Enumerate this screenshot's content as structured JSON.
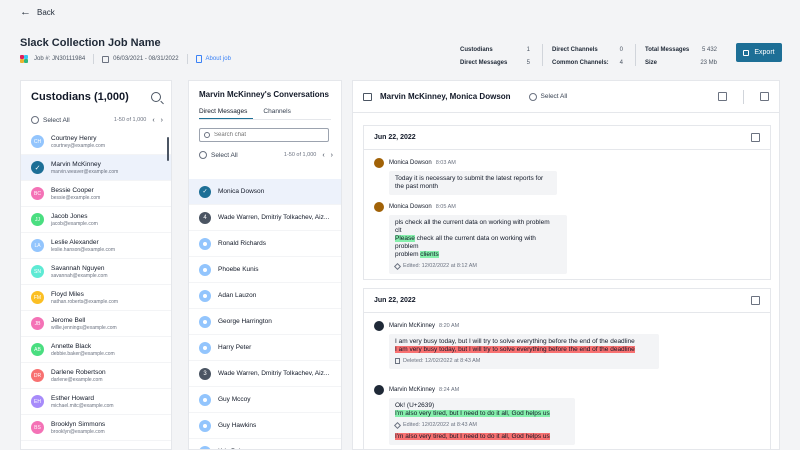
{
  "header": {
    "back_label": "Back",
    "job_title": "Slack Collection Job Name",
    "job_number": "Job #: JN30111984",
    "date_range": "06/03/2021 - 08/31/2022",
    "about_job": "About job",
    "export_label": "Export"
  },
  "stats": {
    "custodians_label": "Custodians",
    "custodians_value": "1",
    "direct_messages_label": "Direct Messages",
    "direct_messages_value": "5",
    "direct_channels_label": "Direct Channels",
    "direct_channels_value": "0",
    "common_channels_label": "Common Channels:",
    "common_channels_value": "4",
    "total_messages_label": "Total Messages",
    "total_messages_value": "5 432",
    "size_label": "Size",
    "size_value": "23 Mb"
  },
  "custodians": {
    "title": "Custodians (1,000)",
    "select_all": "Select All",
    "pager_text": "1-50 of 1,000",
    "items": [
      {
        "initials": "CH",
        "name": "Courtney Henry",
        "email": "courtney@example.com",
        "color": "#93c5fd"
      },
      {
        "initials": "",
        "name": "Marvin McKinney",
        "email": "marvin.weaver@example.com",
        "color": "#1d6f96"
      },
      {
        "initials": "BC",
        "name": "Bessie Cooper",
        "email": "bessie@example.com",
        "color": "#f472b6"
      },
      {
        "initials": "JJ",
        "name": "Jacob Jones",
        "email": "jacob@example.com",
        "color": "#4ade80"
      },
      {
        "initials": "LA",
        "name": "Leslie Alexander",
        "email": "leslie.hanson@example.com",
        "color": "#93c5fd"
      },
      {
        "initials": "SN",
        "name": "Savannah Nguyen",
        "email": "savannah@example.com",
        "color": "#5eead4"
      },
      {
        "initials": "FM",
        "name": "Floyd Miles",
        "email": "nathan.roberts@example.com",
        "color": "#fbbf24"
      },
      {
        "initials": "JB",
        "name": "Jerome Bell",
        "email": "willie.jennings@example.com",
        "color": "#f472b6"
      },
      {
        "initials": "AB",
        "name": "Annette Black",
        "email": "debbie.baker@example.com",
        "color": "#4ade80"
      },
      {
        "initials": "DR",
        "name": "Darlene Robertson",
        "email": "darlene@example.com",
        "color": "#f87171"
      },
      {
        "initials": "EH",
        "name": "Esther Howard",
        "email": "michael.mitc@example.com",
        "color": "#a78bfa"
      },
      {
        "initials": "BS",
        "name": "Brooklyn Simmons",
        "email": "brooklyn@example.com",
        "color": "#f472b6"
      }
    ]
  },
  "conversations": {
    "title": "Marvin McKinney's Conversations",
    "tabs": [
      "Direct Messages",
      "Channels"
    ],
    "search_placeholder": "Search chat",
    "select_all": "Select All",
    "pager_text": "1-50 of 1,000",
    "items": [
      {
        "type": "selected",
        "label": "Monica Dowson",
        "badge": ""
      },
      {
        "type": "group",
        "label": "Wade Warren, Dmitriy Tolkachev, Aiz...",
        "badge": "4"
      },
      {
        "type": "person",
        "label": "Ronald Richards",
        "badge": ""
      },
      {
        "type": "person",
        "label": "Phoebe Kunis",
        "badge": ""
      },
      {
        "type": "person",
        "label": "Adan Lauzon",
        "badge": ""
      },
      {
        "type": "person",
        "label": "George Harrington",
        "badge": ""
      },
      {
        "type": "person",
        "label": "Harry Peter",
        "badge": ""
      },
      {
        "type": "group",
        "label": "Wade Warren, Dmitriy Tolkachev, Aiz...",
        "badge": "3"
      },
      {
        "type": "person",
        "label": "Guy Mccoy",
        "badge": ""
      },
      {
        "type": "person",
        "label": "Guy Hawkins",
        "badge": ""
      },
      {
        "type": "person",
        "label": "Kris Peber",
        "badge": ""
      }
    ]
  },
  "chat": {
    "title": "Marvin McKinney, Monica Dowson",
    "select_all": "Select All",
    "day1": {
      "date": "Jun 22, 2022",
      "msg1": {
        "author": "Monica Dowson",
        "time": "8:03 AM",
        "text1": "Today it is necessary to submit the latest reports for",
        "text2": "the past month"
      },
      "msg2": {
        "author": "Monica Dowson",
        "time": "8:05 AM",
        "orig1": "pls check all the current data on working with problem",
        "orig2": "clt",
        "hl_word1": "Please",
        "rest1": " check all the current data on working with problem",
        "plain2": "problem ",
        "hl_word2": "clients",
        "edited": "Edited: 12/02/2022 at 8:12 AM"
      }
    },
    "day2": {
      "date": "Jun 22, 2022",
      "msg1": {
        "author": "Marvin McKinney",
        "time": "8:20 AM",
        "text": "I am very busy today, but I will try to solve everything before the end of the deadline",
        "deleted_text": "I am very busy today, but I will try to solve everything before the end of the deadline",
        "deleted": "Deleted: 12/02/2022 at 8:43 AM"
      },
      "msg2": {
        "author": "Marvin McKinney",
        "time": "8:24 AM",
        "text": "Ok! (U+2639)",
        "green": "I'm also very tired, but I need to do it all, God helps us",
        "edited": "Edited: 12/02/2022 at 8:43 AM",
        "red": "I'm also very tired, but I need to do it all, God helps us"
      }
    }
  }
}
